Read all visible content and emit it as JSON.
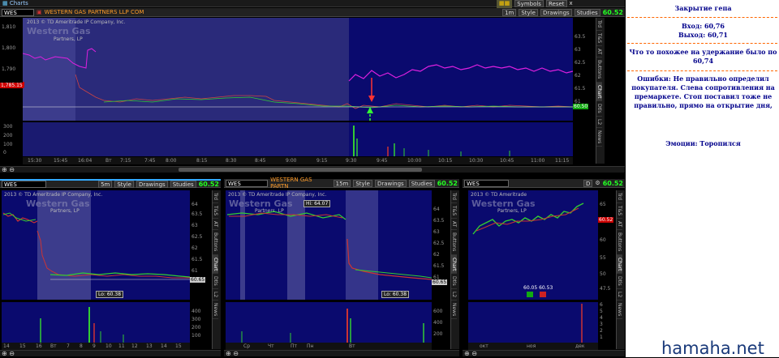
{
  "app": {
    "title": "Charts",
    "close_label": "x"
  },
  "top": {
    "symbol": "WES",
    "description": "WESTERN GAS PARTNERS LLP COM",
    "buttons": {
      "period": "1m",
      "style": "Style",
      "drawings": "Drawings",
      "studies": "Studies",
      "symbols": "Symbols",
      "reset": "Reset"
    },
    "price": "60.52",
    "watermark": "Western Gas",
    "copyright": "2013 © TD Ameritrade IP Company, Inc.",
    "partners": "Partners, LP",
    "y_left": [
      "1,810",
      "1,800",
      "1,790"
    ],
    "y_left_tag": "1,785.15",
    "y_right": [
      "63.5",
      "63",
      "62.5",
      "62",
      "61.5",
      "61",
      "60.5"
    ],
    "price_tag": "60.50",
    "vol_ticks": [
      "300",
      "200",
      "100",
      "0"
    ],
    "x_ticks": [
      "15:30",
      "15:45",
      "16:04",
      "Вт",
      "7:15",
      "7:45",
      "8:00",
      "8:15",
      "8:30",
      "8:45",
      "9:00",
      "9:15",
      "9:30",
      "9:45",
      "10:00",
      "10:15",
      "10:30",
      "10:45",
      "11:00",
      "11:15"
    ],
    "side_tabs": [
      "Trd",
      "T&S",
      "AT",
      "Buttons",
      "Chart",
      "Dtls",
      "L2",
      "News"
    ]
  },
  "bl": {
    "symbol": "WES",
    "period": "5m",
    "price": "60.52",
    "buttons": {
      "style": "Style",
      "drawings": "Drawings",
      "studies": "Studies"
    },
    "copyright": "2013 © TD Ameritrade IP Company, Inc.",
    "watermark": "Western Gas",
    "partners": "Partners, LP",
    "low": "Lo: 60.38",
    "price_tag": "60.65",
    "y": [
      "64",
      "63.5",
      "63",
      "62.5",
      "62",
      "61.5",
      "61",
      "60.5"
    ],
    "vol": [
      "400",
      "300",
      "200",
      "100"
    ],
    "x": [
      "14",
      "15",
      "16",
      "Вт",
      "7",
      "8",
      "9",
      "10",
      "11",
      "12",
      "13",
      "14",
      "15"
    ],
    "side_tabs": [
      "Trd",
      "T&S",
      "AT",
      "Buttons",
      "Chart",
      "Dtls",
      "L2",
      "News"
    ]
  },
  "bm": {
    "symbol": "WES",
    "period": "15m",
    "price": "60.52",
    "buttons": {
      "style": "Style",
      "drawings": "Drawings",
      "studies": "Studies"
    },
    "description": "WESTERN GAS PARTN",
    "copyright": "2013 © TD Ameritrade IP Company, Inc.",
    "watermark": "Western Gas",
    "partners": "Partners, LP",
    "high": "Hi: 64.07",
    "low": "Lo: 60.38",
    "price_tag": "60.65",
    "y": [
      "64",
      "63.5",
      "63",
      "62.5",
      "62",
      "61.5",
      "61",
      "60.5"
    ],
    "vol": [
      "600",
      "400",
      "200"
    ],
    "x": [
      "Ср",
      "Чт",
      "Пт",
      "Пн",
      "Вт"
    ],
    "side_tabs": [
      "Trd",
      "T&S",
      "AT",
      "Buttons",
      "Chart",
      "Dtls",
      "L2",
      "News"
    ]
  },
  "br": {
    "symbol": "WES",
    "period": "D",
    "price": "60.52",
    "copyright": "2013 © TD Ameritrade",
    "watermark": "Western Gas",
    "partners": "Partners, LP",
    "price_tag": "60.52",
    "marker_label": "60.05 60.53",
    "y": [
      "65",
      "60",
      "55",
      "50",
      "47.5"
    ],
    "vol": [
      "6",
      "5",
      "4",
      "3",
      "2",
      "1"
    ],
    "x": [
      "окт",
      "ноя",
      "дек"
    ],
    "side_tabs": [
      "Trd",
      "T&S",
      "AT",
      "Buttons",
      "Chart",
      "Dtls",
      "L2",
      "News"
    ]
  },
  "notes": {
    "title": "Закрытие гепа",
    "entry": "Вход: 60,76",
    "exit": "Выход: 60,71",
    "hold": "Что то похожее на удержание было по 60,74",
    "errors": "Ошибки: Не правильно определил покупателя. Слева сопротивления на премаркете. Стоп поставил тоже не правильно, прямо на открытие дня,",
    "emotions": "Эмоции: Торопился"
  },
  "footer": {
    "site": "hamaha.net"
  }
}
